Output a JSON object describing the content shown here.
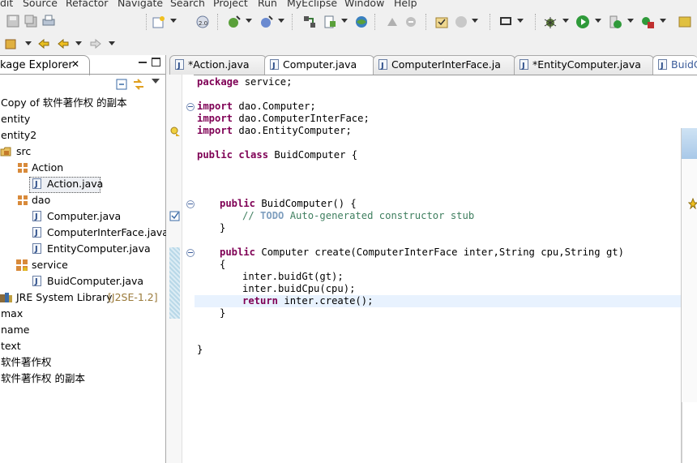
{
  "menu": [
    "dit",
    "Source",
    "Refactor",
    "Navigate",
    "Search",
    "Project",
    "Run",
    "MyEclipse",
    "Window",
    "Help"
  ],
  "left_panel": {
    "title": "kage Explorer",
    "close_glyph": "✕",
    "tree": [
      {
        "label": "Copy of 软件著作权 的副本"
      },
      {
        "label": "entity"
      },
      {
        "label": "entity2"
      },
      {
        "label": "src"
      },
      {
        "label": "Action"
      },
      {
        "label": "Action.java"
      },
      {
        "label": "dao"
      },
      {
        "label": "Computer.java"
      },
      {
        "label": "ComputerInterFace.java"
      },
      {
        "label": "EntityComputer.java"
      },
      {
        "label": "service"
      },
      {
        "label": "BuidComputer.java"
      },
      {
        "label": "JRE System Library"
      },
      {
        "label": "max"
      },
      {
        "label": "name"
      },
      {
        "label": "text"
      },
      {
        "label": "软件著作权"
      },
      {
        "label": "软件著作权 的副本"
      }
    ],
    "jre_version": "[J2SE-1.2]"
  },
  "editor": {
    "tabs": [
      "*Action.java",
      "Computer.java",
      "ComputerInterFace.ja",
      "*EntityComputer.java",
      "BuidC"
    ],
    "code": {
      "l1_kw": "package",
      "l1_rest": " service;",
      "imp": "import",
      "l2_rest": " dao.Computer;",
      "l3_rest": " dao.ComputerInterFace;",
      "l4_rest": " dao.EntityComputer;",
      "l5_kw1": "public",
      "l5_kw2": "class",
      "l5_rest": " BuidComputer {",
      "l6_kw": "public",
      "l6_rest": " BuidComputer() {",
      "l7_cm1": "// ",
      "l7_todo": "TODO",
      "l7_cm2": " Auto-generated constructor stub",
      "close_brace": "}",
      "l9_kw": "public",
      "l9_rest": " Computer create(ComputerInterFace inter,String cpu,String gt)",
      "l10": "{",
      "l11": "inter.buidGt(gt);",
      "l12": "inter.buidCpu(cpu);",
      "l13_kw": "return",
      "l13_rest": " inter.create();"
    }
  },
  "colors": {
    "keyword": "#7f0055",
    "comment": "#3f7f5f",
    "todo": "#7f9fbf",
    "current_line": "#e8f2fe"
  },
  "icons": [
    "save-icon",
    "save-all-icon",
    "print-icon",
    "new-wizard-icon",
    "debug-icon",
    "run-icon",
    "external-tools-icon",
    "open-type-icon",
    "search-icon",
    "globe-icon",
    "back-icon",
    "forward-icon",
    "package-icon",
    "java-file-icon"
  ]
}
